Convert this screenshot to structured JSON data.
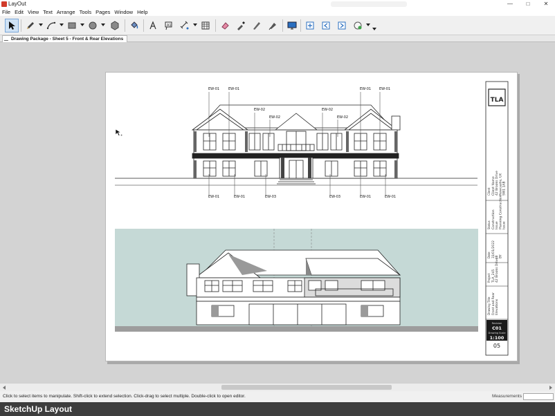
{
  "window": {
    "app_title": "LayOut",
    "controls": [
      "—",
      "□",
      "✕"
    ]
  },
  "menu": [
    "File",
    "Edit",
    "View",
    "Text",
    "Arrange",
    "Tools",
    "Pages",
    "Window",
    "Help"
  ],
  "toolbar": {
    "tools": [
      "select-tool",
      "line-tool",
      "arc-tool",
      "rectangle-tool",
      "circle-tool",
      "polygon-tool",
      "style-tool",
      "text-tool",
      "label-tool",
      "dimension-tool",
      "table-tool",
      "erase-tool",
      "style-sample-tool",
      "split-tool",
      "join-tool",
      "presentation-mode",
      "add-page",
      "previous-page",
      "next-page",
      "sharing"
    ]
  },
  "document_tab": {
    "label": "Drawing Package - Sheet 5 - Front & Rear Elevations"
  },
  "title_block": {
    "logo": "TLA",
    "revision_label": "Revision",
    "revision": "C01",
    "scale_label": "Drawing Scale",
    "scale": "1:100",
    "sheet_number": "05",
    "client_label": "Client",
    "client_value": "Client Name\n42 Brooks Drive\nNewcastle, UK\nSW1 1AB",
    "status_label": "Status",
    "status_value": "Construction\nIssue\nPlanning Construction\nIssue",
    "date_label": "Date",
    "date_value": "31/01/2022\nJB\nBY",
    "project_label": "Project",
    "project_value": "TLA_245\n42 Brooks Drive",
    "drawing_label": "Drawing Title",
    "drawing_value": "Front and Rear\nElevations"
  },
  "annotations": {
    "top": [
      "EW-01",
      "EW-01",
      "EW-02",
      "EW-02",
      "EW-02",
      "EW-02",
      "EW-01",
      "EW-01"
    ],
    "bottom": [
      "EW-01",
      "EW-01",
      "EW-03",
      "EW-03",
      "EW-01",
      "EW-01"
    ]
  },
  "colors": {
    "rear_sky": "#c5d9d6",
    "ground": "#9d9d9d",
    "accent": "#2a6fc0"
  },
  "scrollbar": {
    "left_arrow": "<",
    "right_arrow": ">"
  },
  "status": {
    "hint": "Click to select items to manipulate. Shift-click to extend selection. Click-drag to select multiple. Double-click to open editor.",
    "measurements_label": "Measurements",
    "measurements_value": ""
  },
  "caption": "SketchUp Layout"
}
